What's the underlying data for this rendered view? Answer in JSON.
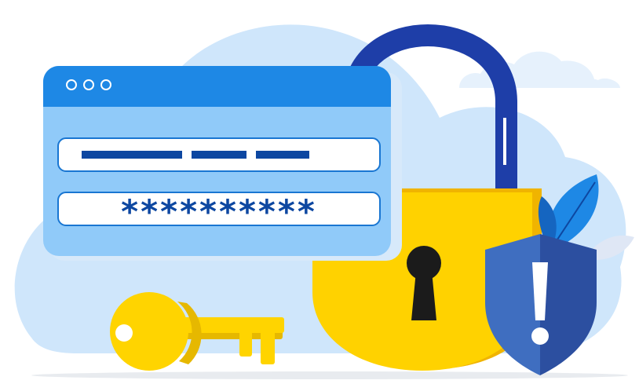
{
  "login_window": {
    "controls": [
      "window-dot",
      "window-dot",
      "window-dot"
    ],
    "username_field": {
      "icon": "text-dashes"
    },
    "password_field": {
      "value": "**********"
    }
  },
  "padlock": {
    "state": "unlocked",
    "icon": "keyhole-icon"
  },
  "shield": {
    "icon": "exclamation-icon"
  },
  "key": {
    "icon": "key-icon"
  },
  "colors": {
    "cloud_back": "#cfe6fb",
    "cloud_front": "#e6f1fc",
    "window_header": "#1e88e5",
    "window_body": "#90caf9",
    "field_border": "#1976d2",
    "field_text": "#0d47a1",
    "lock_body": "#ffd200",
    "lock_shackle": "#1e3ea8",
    "shield_light": "#3f6ec0",
    "shield_dark": "#2c4fa0",
    "key": "#ffd400",
    "leaf": "#1e88e5"
  }
}
